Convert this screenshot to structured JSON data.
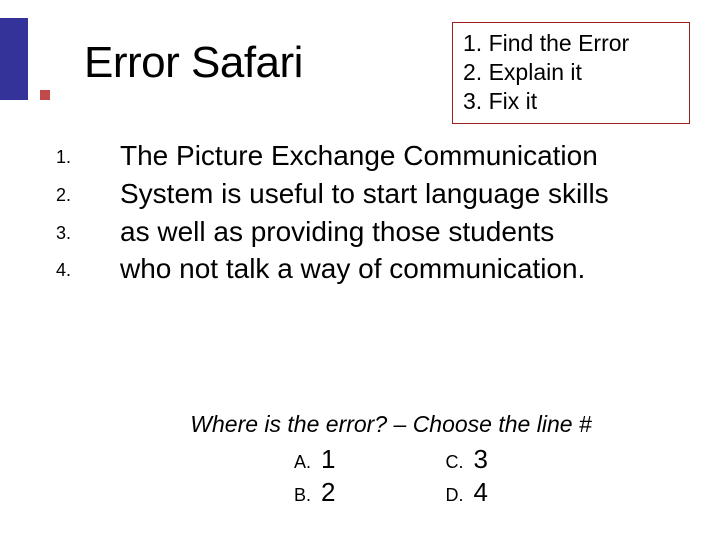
{
  "title": "Error Safari",
  "steps": {
    "line1": "1. Find the Error",
    "line2": "2. Explain it",
    "line3": "3. Fix it"
  },
  "sentence_lines": [
    "The Picture Exchange Communication",
    "System is useful to start language skills",
    "as well as providing those students",
    "who not talk a way of communication."
  ],
  "question": "Where is the error? – Choose the line #",
  "options": {
    "a": {
      "letter": "A.",
      "value": "1"
    },
    "b": {
      "letter": "B.",
      "value": "2"
    },
    "c": {
      "letter": "C.",
      "value": "3"
    },
    "d": {
      "letter": "D.",
      "value": "4"
    }
  },
  "colors": {
    "accent_blue": "#33339a",
    "accent_red": "#c04a4a",
    "box_border": "#9a1f1f"
  }
}
